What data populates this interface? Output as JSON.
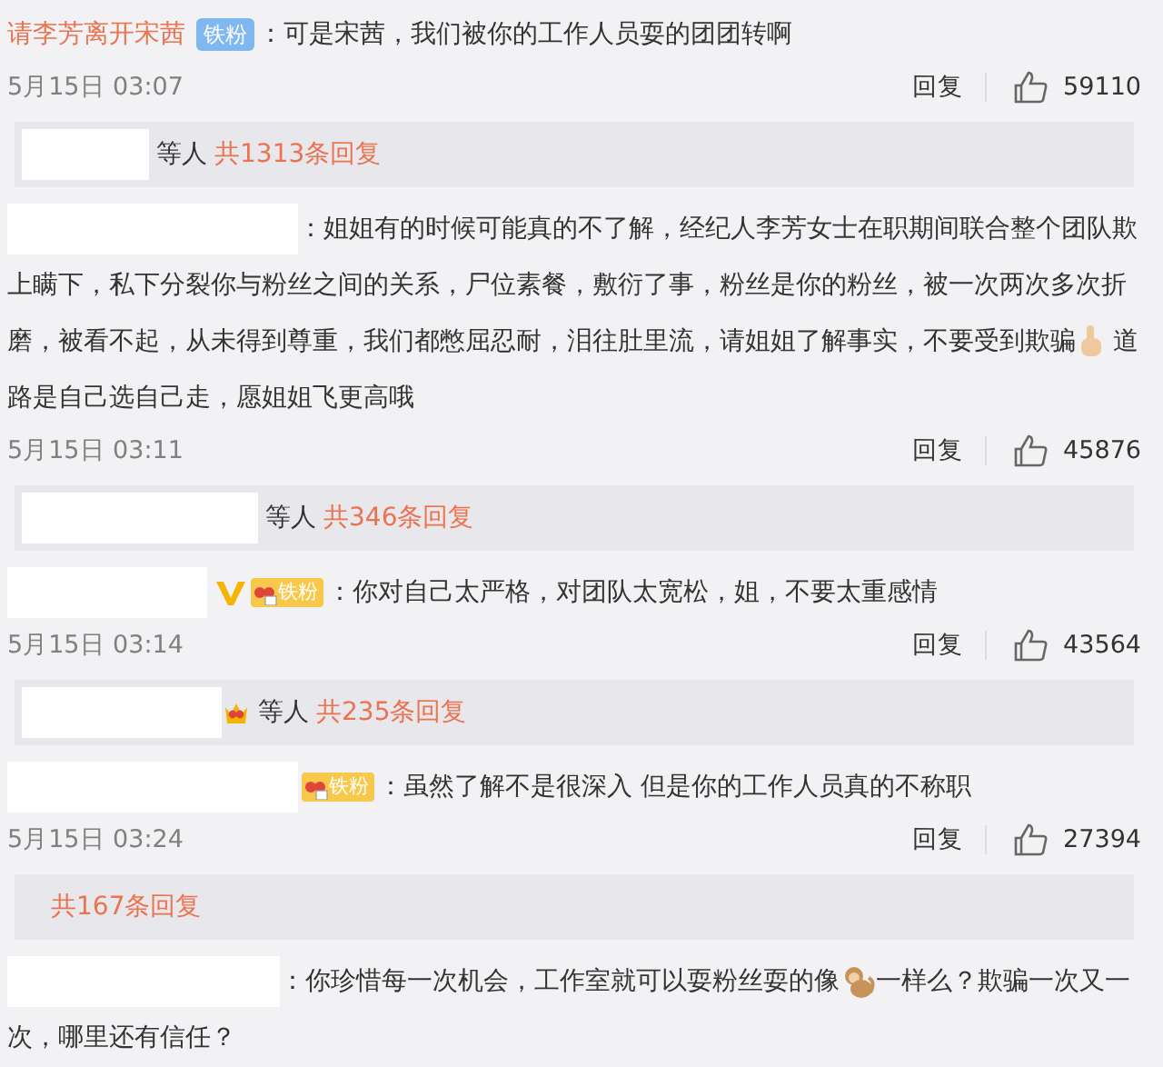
{
  "comments": [
    {
      "user": {
        "redacted": false,
        "name": "请李芳离开宋茜"
      },
      "badges": [
        {
          "kind": "fan-plain",
          "text": "铁粉"
        }
      ],
      "separator": "：",
      "segments": [
        {
          "kind": "text",
          "text": "可是宋茜，我们被你的工作人员耍的团团转啊"
        }
      ],
      "date": "5月15日 03:07",
      "reply": "回复",
      "likes": "59110",
      "summary": {
        "users_redacted": true,
        "crown": false,
        "suffix": "等人",
        "count": "共1313条回复"
      }
    },
    {
      "user": {
        "redacted": true
      },
      "separator": "：",
      "segments": [
        {
          "kind": "text",
          "text": "姐姐有的时候可能真的不了解，经纪人李芳女士在职期间联合整个团队欺上瞒下，私下分裂你与粉丝之间的关系，尸位素餐，敷衍了事，粉丝是你的粉丝，被一次两次多次折磨，被看不起，从未得到尊重，我们都憋屈忍耐，泪往肚里流，请姐姐了解事实，不要受到欺骗"
        },
        {
          "kind": "finger"
        },
        {
          "kind": "text",
          "text": " 道路是自己选自己走，愿姐姐飞更高哦"
        }
      ],
      "date": "5月15日 03:11",
      "reply": "回复",
      "likes": "45876",
      "summary": {
        "users_redacted": true,
        "crown": false,
        "suffix": "等人",
        "count": "共346条回复"
      }
    },
    {
      "user": {
        "redacted": true
      },
      "badges": [
        {
          "kind": "verified"
        },
        {
          "kind": "fan-crown",
          "text": "铁粉"
        }
      ],
      "separator": "：",
      "segments": [
        {
          "kind": "text",
          "text": "你对自己太严格，对团队太宽松，姐，不要太重感情"
        }
      ],
      "date": "5月15日 03:14",
      "reply": "回复",
      "likes": "43564",
      "summary": {
        "users_redacted": true,
        "crown": true,
        "suffix": "等人",
        "count": "共235条回复"
      }
    },
    {
      "user": {
        "redacted": true
      },
      "badges": [
        {
          "kind": "fan-crown",
          "text": "铁粉"
        }
      ],
      "separator": "：",
      "segments": [
        {
          "kind": "text",
          "text": "虽然了解不是很深入 但是你的工作人员真的不称职"
        }
      ],
      "date": "5月15日 03:24",
      "reply": "回复",
      "likes": "27394",
      "summary": {
        "users_redacted": false,
        "crown": false,
        "count": "共167条回复"
      }
    },
    {
      "user": {
        "redacted": true
      },
      "separator": "：",
      "segments": [
        {
          "kind": "text",
          "text": "你珍惜每一次机会，工作室就可以耍粉丝耍的像"
        },
        {
          "kind": "monkey"
        },
        {
          "kind": "text",
          "text": "一样么？欺骗一次又一次，哪里还有信任？"
        }
      ]
    }
  ]
}
